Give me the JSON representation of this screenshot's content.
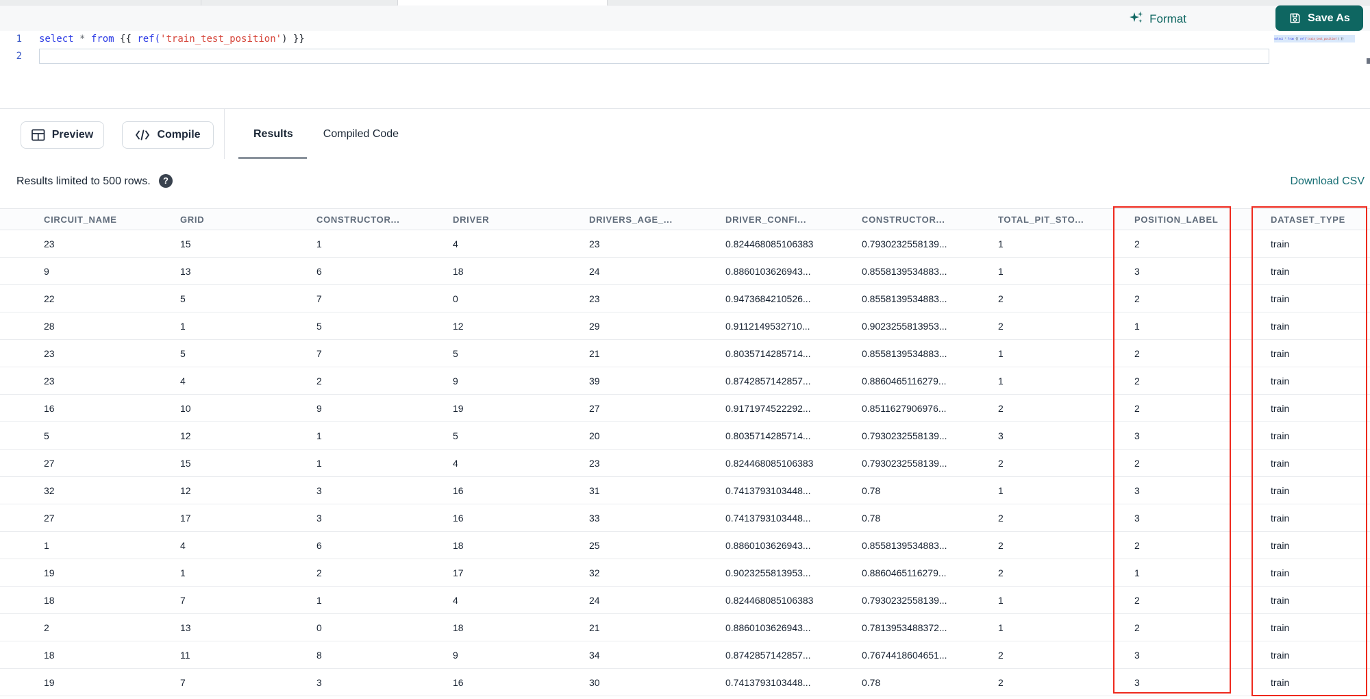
{
  "toolbar": {
    "format_label": "Format",
    "save_as_label": "Save As"
  },
  "editor": {
    "line_numbers": [
      "1",
      "2"
    ],
    "code_tokens": [
      {
        "text": "select",
        "type": "keyword"
      },
      {
        "text": " ",
        "type": "plain"
      },
      {
        "text": "*",
        "type": "operator"
      },
      {
        "text": " ",
        "type": "plain"
      },
      {
        "text": "from",
        "type": "keyword"
      },
      {
        "text": " {{ ",
        "type": "plain"
      },
      {
        "text": "ref(",
        "type": "function"
      },
      {
        "text": "'train_test_position'",
        "type": "string"
      },
      {
        "text": ") }}",
        "type": "plain"
      }
    ]
  },
  "actions": {
    "preview_label": "Preview",
    "compile_label": "Compile"
  },
  "tabs": [
    {
      "label": "Results",
      "active": true
    },
    {
      "label": "Compiled Code",
      "active": false
    }
  ],
  "results_bar": {
    "limit_text": "Results limited to 500 rows.",
    "help_glyph": "?",
    "download_label": "Download CSV"
  },
  "table": {
    "columns": [
      "CIRCUIT_NAME",
      "GRID",
      "CONSTRUCTOR...",
      "DRIVER",
      "DRIVERS_AGE_...",
      "DRIVER_CONFI...",
      "CONSTRUCTOR...",
      "TOTAL_PIT_STO...",
      "POSITION_LABEL",
      "DATASET_TYPE"
    ],
    "highlighted_columns": [
      "POSITION_LABEL",
      "DATASET_TYPE"
    ],
    "rows": [
      [
        "23",
        "15",
        "1",
        "4",
        "23",
        "0.824468085106383",
        "0.7930232558139...",
        "1",
        "2",
        "train"
      ],
      [
        "9",
        "13",
        "6",
        "18",
        "24",
        "0.8860103626943...",
        "0.8558139534883...",
        "1",
        "3",
        "train"
      ],
      [
        "22",
        "5",
        "7",
        "0",
        "23",
        "0.9473684210526...",
        "0.8558139534883...",
        "2",
        "2",
        "train"
      ],
      [
        "28",
        "1",
        "5",
        "12",
        "29",
        "0.9112149532710...",
        "0.9023255813953...",
        "2",
        "1",
        "train"
      ],
      [
        "23",
        "5",
        "7",
        "5",
        "21",
        "0.8035714285714...",
        "0.8558139534883...",
        "1",
        "2",
        "train"
      ],
      [
        "23",
        "4",
        "2",
        "9",
        "39",
        "0.8742857142857...",
        "0.8860465116279...",
        "1",
        "2",
        "train"
      ],
      [
        "16",
        "10",
        "9",
        "19",
        "27",
        "0.9171974522292...",
        "0.8511627906976...",
        "2",
        "2",
        "train"
      ],
      [
        "5",
        "12",
        "1",
        "5",
        "20",
        "0.8035714285714...",
        "0.7930232558139...",
        "3",
        "3",
        "train"
      ],
      [
        "27",
        "15",
        "1",
        "4",
        "23",
        "0.824468085106383",
        "0.7930232558139...",
        "2",
        "2",
        "train"
      ],
      [
        "32",
        "12",
        "3",
        "16",
        "31",
        "0.7413793103448...",
        "0.78",
        "1",
        "3",
        "train"
      ],
      [
        "27",
        "17",
        "3",
        "16",
        "33",
        "0.7413793103448...",
        "0.78",
        "2",
        "3",
        "train"
      ],
      [
        "1",
        "4",
        "6",
        "18",
        "25",
        "0.8860103626943...",
        "0.8558139534883...",
        "2",
        "2",
        "train"
      ],
      [
        "19",
        "1",
        "2",
        "17",
        "32",
        "0.9023255813953...",
        "0.8860465116279...",
        "2",
        "1",
        "train"
      ],
      [
        "18",
        "7",
        "1",
        "4",
        "24",
        "0.824468085106383",
        "0.7930232558139...",
        "1",
        "2",
        "train"
      ],
      [
        "2",
        "13",
        "0",
        "18",
        "21",
        "0.8860103626943...",
        "0.7813953488372...",
        "1",
        "2",
        "train"
      ],
      [
        "18",
        "11",
        "8",
        "9",
        "34",
        "0.8742857142857...",
        "0.7674418604651...",
        "2",
        "3",
        "train"
      ],
      [
        "19",
        "7",
        "3",
        "16",
        "30",
        "0.7413793103448...",
        "0.78",
        "2",
        "3",
        "train"
      ]
    ]
  },
  "colors": {
    "accent_teal": "#0e6661",
    "link_teal": "#176e74",
    "highlight_red": "#ee291d",
    "keyword_blue": "#2d3ce5",
    "string_red": "#d6453a"
  }
}
